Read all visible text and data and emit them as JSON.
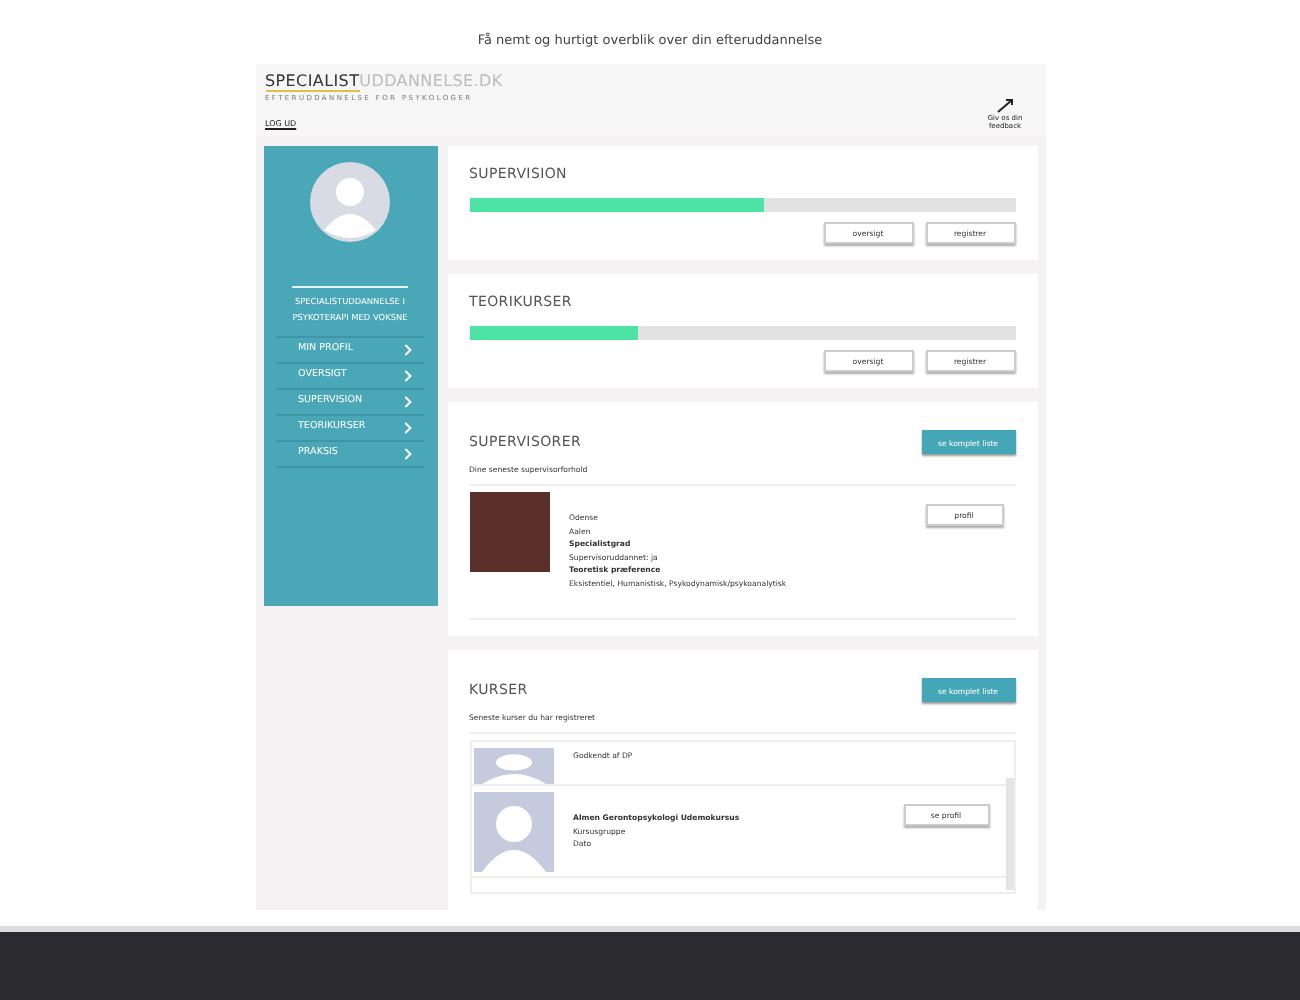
{
  "subtitle": "Få nemt og hurtigt overblik over din efteruddannelse",
  "header": {
    "logo_bold": "SPECIALIST",
    "logo_light": "UDDANNELSE.DK",
    "tagline": "EFTERUDDANNELSE FOR PSYKOLOGER",
    "logout": "LOG UD",
    "feedback": "Giv os din feedback"
  },
  "sidebar": {
    "program": "SPECIALISTUDDANNELSE I PSYKOTERAPI MED VOKSNE",
    "items": [
      {
        "label": "MIN PROFIL",
        "selected": false
      },
      {
        "label": "OVERSIGT",
        "selected": false
      },
      {
        "label": "SUPERVISION",
        "selected": false
      },
      {
        "label": "TEORIKURSER",
        "selected": false
      },
      {
        "label": "PRAKSIS",
        "selected": false
      }
    ]
  },
  "progress_cards": [
    {
      "title": "SUPERVISION",
      "level": 0.54,
      "buttons": [
        "oversigt",
        "registrer"
      ]
    },
    {
      "title": "TEORIKURSER",
      "level": 0.31,
      "buttons": [
        "oversigt",
        "registrer"
      ]
    }
  ],
  "supervisors": {
    "title": "SUPERVISORER",
    "action": "se komplet liste",
    "note": "Dine seneste supervisorforhold",
    "items": [
      {
        "lines": [
          "Odense",
          "Aalen",
          "**Specialistgrad**",
          "Supervisoruddannet: ja",
          "**Teoretisk præference**",
          "Eksistentiel, Humanistisk, Psykodynamisk/psykoanalytisk"
        ],
        "button": "profil"
      }
    ]
  },
  "courses": {
    "title": "KURSER",
    "action": "se komplet liste",
    "note": "Seneste kurser du har registreret",
    "items": [
      {
        "lines": [
          "Godkendt af DP"
        ],
        "cut": true
      },
      {
        "lines": [
          "**Almen Gerontopsykologi Udemokursus**",
          "Kursusgruppe",
          "Dato"
        ],
        "button": "se profil",
        "cut": false
      }
    ]
  }
}
